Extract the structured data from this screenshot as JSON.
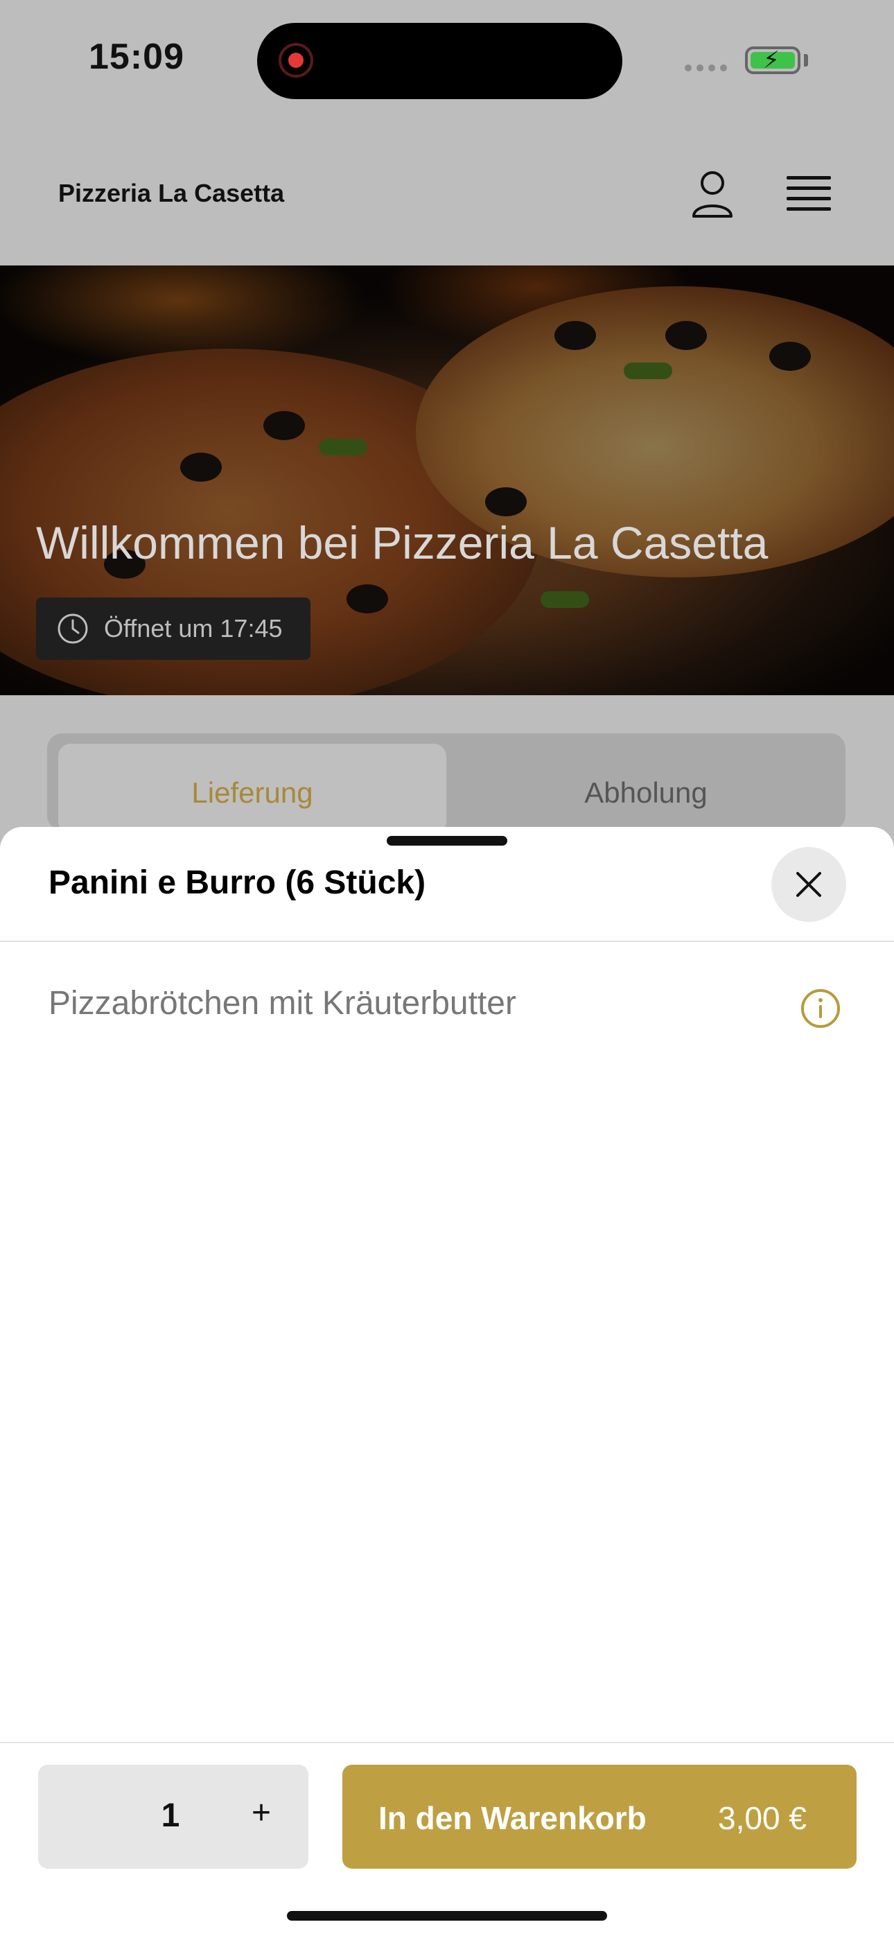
{
  "status_bar": {
    "time": "15:09"
  },
  "header": {
    "title": "Pizzeria La Casetta",
    "user_icon": "person-icon",
    "menu_icon": "hamburger-icon"
  },
  "hero": {
    "title": "Willkommen bei Pizzeria La Casetta",
    "open_text": "Öffnet um 17:45"
  },
  "tabs": [
    {
      "label": "Lieferung",
      "active": true
    },
    {
      "label": "Abholung",
      "active": false
    }
  ],
  "sheet": {
    "title": "Panini e Burro (6 Stück)",
    "description": "Pizzabrötchen mit Kräuterbutter",
    "quantity": "1",
    "plus_label": "+",
    "add_to_cart_label": "In den Warenkorb",
    "price": "3,00 €"
  },
  "colors": {
    "accent": "#bea042",
    "accent_text": "#a8893a",
    "sheet_bg": "#ffffff",
    "dim_bg": "#bdbdbd"
  }
}
